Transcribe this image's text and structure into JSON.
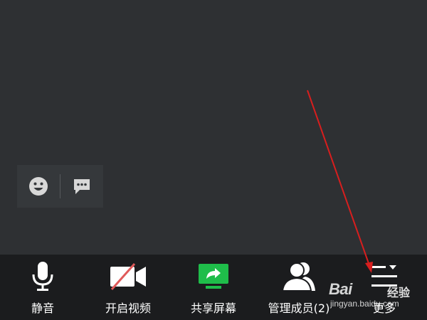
{
  "toolbar": {
    "items": [
      {
        "label": "静音",
        "icon": "microphone-icon"
      },
      {
        "label": "开启视频",
        "icon": "video-off-icon"
      },
      {
        "label": "共享屏幕",
        "icon": "share-screen-icon"
      },
      {
        "label": "管理成员(2)",
        "icon": "members-icon"
      },
      {
        "label": "更多",
        "icon": "more-menu-icon"
      }
    ]
  },
  "reactions": {
    "items": [
      {
        "icon": "emoji-icon"
      },
      {
        "icon": "chat-icon"
      }
    ]
  },
  "colors": {
    "background": "#2e3033",
    "toolbar": "#1b1c1e",
    "share_green": "#1fbd4a",
    "video_off_red": "#e05a5a",
    "annotation_arrow": "#d81e1e"
  },
  "watermark": {
    "brand": "Bai",
    "brand_suffix": "经验",
    "url": "jingyan.baidu.com"
  }
}
